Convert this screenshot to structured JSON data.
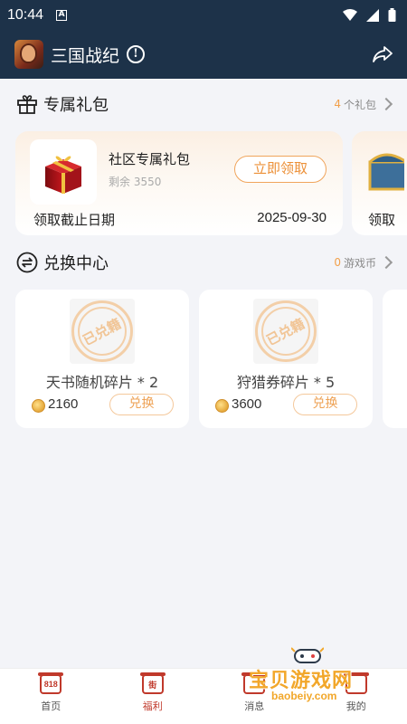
{
  "status_bar": {
    "time": "10:44",
    "notification_letter": "A"
  },
  "app_bar": {
    "title": "三国战纪",
    "info_symbol": "!"
  },
  "gifts_section": {
    "title": "专属礼包",
    "count": "4",
    "count_suffix": "个礼包",
    "cards": [
      {
        "name": "社区专属礼包",
        "remaining": "剩余 3550",
        "claim_label": "立即领取",
        "deadline_label": "领取截止日期",
        "deadline_date": "2025-09-30"
      },
      {
        "deadline_label": "领取"
      }
    ]
  },
  "exchange_section": {
    "title": "兑换中心",
    "balance": "0",
    "balance_suffix": "游戏币",
    "items": [
      {
        "stamp": "已兑籍",
        "name": "天书随机碎片 * 2",
        "price": "2160",
        "button": "兑换"
      },
      {
        "stamp": "已兑籍",
        "name": "狩猎券碎片 * 5",
        "price": "3600",
        "button": "兑换"
      }
    ]
  },
  "tab_bar": {
    "tabs": [
      {
        "label": "首页",
        "icon_text": "818",
        "icon": "home-818-icon",
        "active": false
      },
      {
        "label": "福利",
        "icon_text": "街",
        "icon": "welfare-icon",
        "active": true
      },
      {
        "label": "消息",
        "icon_text": "",
        "icon": "message-icon",
        "active": false
      },
      {
        "label": "我的",
        "icon_text": "",
        "icon": "profile-icon",
        "active": false
      }
    ]
  },
  "watermark": {
    "text": "宝贝游戏网",
    "url": "baobeiy.com"
  },
  "colors": {
    "header_bg": "#1d3249",
    "accent_orange": "#ec8f36",
    "tab_active": "#c0392b"
  }
}
